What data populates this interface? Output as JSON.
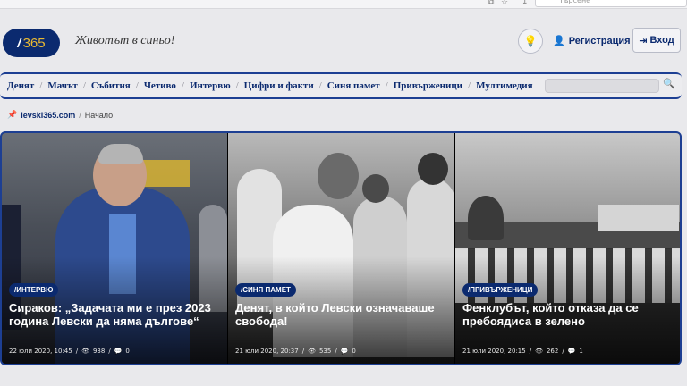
{
  "browser": {
    "search_placeholder": "Търсене"
  },
  "header": {
    "logo_slash": "/",
    "logo_number": "365",
    "tagline": "Животът в синьо!",
    "register_label": "Регистрация",
    "login_label": "Вход"
  },
  "nav": {
    "items": [
      "Денят",
      "Мачът",
      "Събития",
      "Четиво",
      "Интервю",
      "Цифри и факти",
      "Синя памет",
      "Привърженици",
      "Мултимедия"
    ]
  },
  "breadcrumb": {
    "home": "levski365.com",
    "current": "Начало"
  },
  "featured": [
    {
      "category": "/ИНТЕРВЮ",
      "title": "Сираков: „Задачата ми е през 2023 година Левски да няма дългове“",
      "date": "22 юли 2020, 10:45",
      "views": "938",
      "comments": "0"
    },
    {
      "category": "/СИНЯ ПАМЕТ",
      "title": "Денят, в който Левски означаваше свобода!",
      "date": "21 юли 2020, 20:37",
      "views": "535",
      "comments": "0"
    },
    {
      "category": "/ПРИВЪРЖЕНИЦИ",
      "title": "Фенклубът, който отказа да се пребоядиса в зелено",
      "date": "21 юли 2020, 20:15",
      "views": "262",
      "comments": "1"
    }
  ],
  "colors": {
    "brand": "#0b2a6f",
    "accent": "#e8b933",
    "border": "#1d3f93"
  }
}
